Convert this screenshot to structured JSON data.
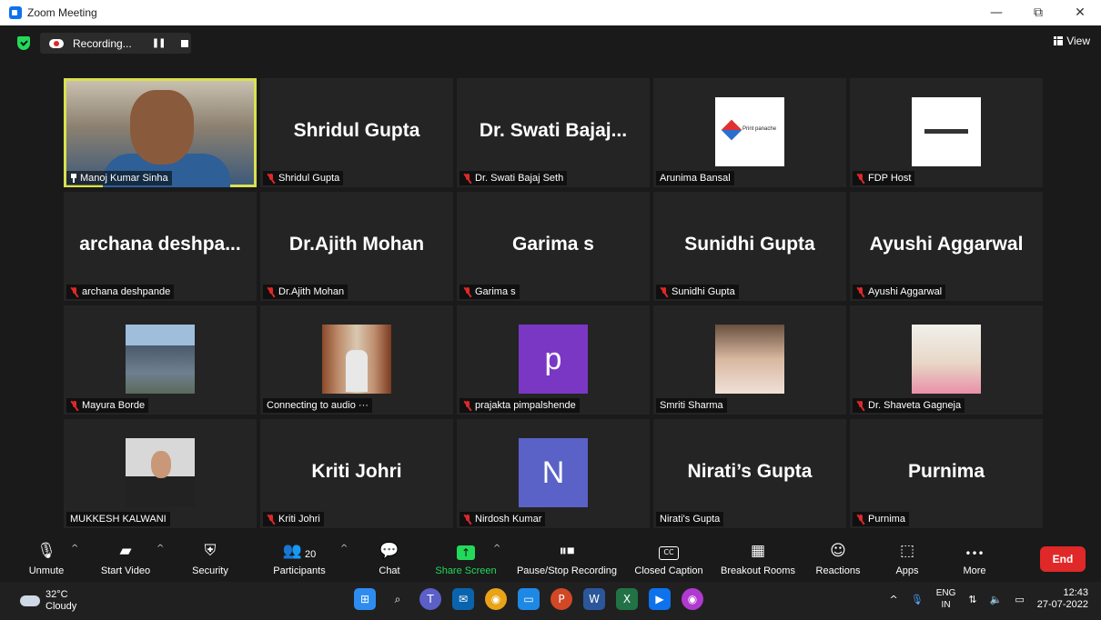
{
  "window": {
    "title": "Zoom Meeting",
    "minimize": "—",
    "maximize": "⧉",
    "close": "✕"
  },
  "meeting_bar": {
    "recording_label": "Recording...",
    "view_label": "View"
  },
  "participants": [
    {
      "name": "Manoj Kumar Sinha",
      "display": "",
      "type": "video",
      "muted": false,
      "pinned": true
    },
    {
      "name": "Shridul Gupta",
      "display": "Shridul Gupta",
      "type": "name",
      "muted": true
    },
    {
      "name": "Dr. Swati Bajaj Seth",
      "display": "Dr. Swati Bajaj...",
      "type": "name",
      "muted": true
    },
    {
      "name": "Arunima Bansal",
      "display": "",
      "type": "logo-print",
      "logo_text": "Print panache",
      "muted": false
    },
    {
      "name": "FDP Host",
      "display": "",
      "type": "logo-digex",
      "muted": true
    },
    {
      "name": "archana deshpande",
      "display": "archana deshpa...",
      "type": "name",
      "muted": true
    },
    {
      "name": "Dr.Ajith Mohan",
      "display": "Dr.Ajith Mohan",
      "type": "name",
      "muted": true
    },
    {
      "name": "Garima s",
      "display": "Garima s",
      "type": "name",
      "muted": true
    },
    {
      "name": "Sunidhi Gupta",
      "display": "Sunidhi Gupta",
      "type": "name",
      "muted": true
    },
    {
      "name": "Ayushi Aggarwal",
      "display": "Ayushi Aggarwal",
      "type": "name",
      "muted": true
    },
    {
      "name": "Mayura Borde",
      "display": "",
      "type": "photo-building",
      "muted": true
    },
    {
      "name": "Connecting to audio ···",
      "display": "",
      "type": "photo-man",
      "muted": false
    },
    {
      "name": "prajakta pimpalshende",
      "display": "p",
      "type": "letter-purple",
      "muted": true
    },
    {
      "name": "Smriti Sharma",
      "display": "",
      "type": "photo-woman1",
      "muted": false
    },
    {
      "name": "Dr. Shaveta Gagneja",
      "display": "",
      "type": "photo-woman2",
      "muted": true
    },
    {
      "name": "MUKKESH KALWANI",
      "display": "",
      "type": "photo-suit",
      "muted": false
    },
    {
      "name": "Kriti Johri",
      "display": "Kriti Johri",
      "type": "name",
      "muted": true
    },
    {
      "name": "Nirdosh Kumar",
      "display": "N",
      "type": "letter-blue",
      "muted": true
    },
    {
      "name": "Nirati's Gupta",
      "display": "Nirati’s Gupta",
      "type": "name",
      "muted": false
    },
    {
      "name": "Purnima",
      "display": "Purnima",
      "type": "name",
      "muted": true
    }
  ],
  "toolbar": {
    "unmute": "Unmute",
    "start_video": "Start Video",
    "security": "Security",
    "participants": "Participants",
    "participants_count": "20",
    "chat": "Chat",
    "share_screen": "Share Screen",
    "pause_stop": "Pause/Stop Recording",
    "closed_caption": "Closed Caption",
    "breakout": "Breakout Rooms",
    "reactions": "Reactions",
    "apps": "Apps",
    "more": "More",
    "end": "End",
    "cc_glyph": "CC",
    "more_glyph": "•••"
  },
  "taskbar": {
    "temperature": "32°C",
    "weather": "Cloudy",
    "lang_top": "ENG",
    "lang_bottom": "IN",
    "time": "12:43",
    "date": "27-07-2022"
  }
}
